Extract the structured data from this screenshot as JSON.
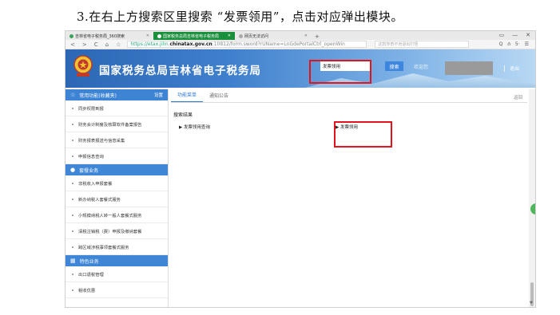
{
  "caption": "3.在右上方搜索区里搜索 “发票领用”，点击对应弹出模块。",
  "browser": {
    "tabs": [
      {
        "label": "吉林省电子税务局_360搜索",
        "active": false
      },
      {
        "label": "国家税务总局吉林省电子税务局",
        "active": true
      },
      {
        "label": "网页无法访问",
        "active": false
      }
    ],
    "new_tab": "+",
    "window_controls": [
      "▭",
      "—",
      "✕"
    ],
    "nav_icons": [
      "<",
      ">",
      "C",
      "⌂",
      "☆"
    ],
    "url_scheme": "https://etax.jilin.",
    "url_host": "chinatax.gov.cn",
    "url_path": ":10812/form.sword?rUName=LnGdePortalCtrl_openWin",
    "search_placeholder": "这款传奇不肯退出打怪",
    "tool_icons": [
      "Q",
      "ሰ",
      "5·",
      "☰"
    ]
  },
  "header": {
    "site_title": "国家税务总局吉林省电子税务局",
    "search_value": "发票领用",
    "search_button": "搜索",
    "user_hint": "欢迎您",
    "separator": "|",
    "logout": "退出"
  },
  "sidebar": {
    "sections": [
      {
        "title": "常用功能(收藏夹)",
        "action": "设置",
        "icon": "star-icon",
        "items": [
          "同步权限到报",
          "财务会计制度及核算软件备案报告",
          "财务报表报送与信息采集",
          "申报信息查询"
        ]
      },
      {
        "title": "套餐业务",
        "action": "",
        "icon": "package-icon",
        "items": [
          "非税收入申报套餐",
          "新办纳税人套餐式服务",
          "小规模纳税人转一般人套餐式服务",
          "清税注销税（费）申报及缴纳套餐",
          "跨区域涉税事项套餐式服务"
        ]
      },
      {
        "title": "特色业务",
        "action": "",
        "icon": "grid-icon",
        "items": [
          "出口退税管理",
          "税收优惠"
        ]
      }
    ]
  },
  "main": {
    "tabs": [
      "功能菜单",
      "通知公告"
    ],
    "active_tab": 0,
    "back": "返回",
    "results_title": "搜索结果",
    "results": [
      "发票领用查询",
      "发票领用"
    ],
    "arrow": "▶"
  },
  "colors": {
    "banner": "#2b67b4",
    "sidebar_header": "#3f86d6",
    "highlight": "#e4121b",
    "active_tab": "#1a8f3c"
  }
}
